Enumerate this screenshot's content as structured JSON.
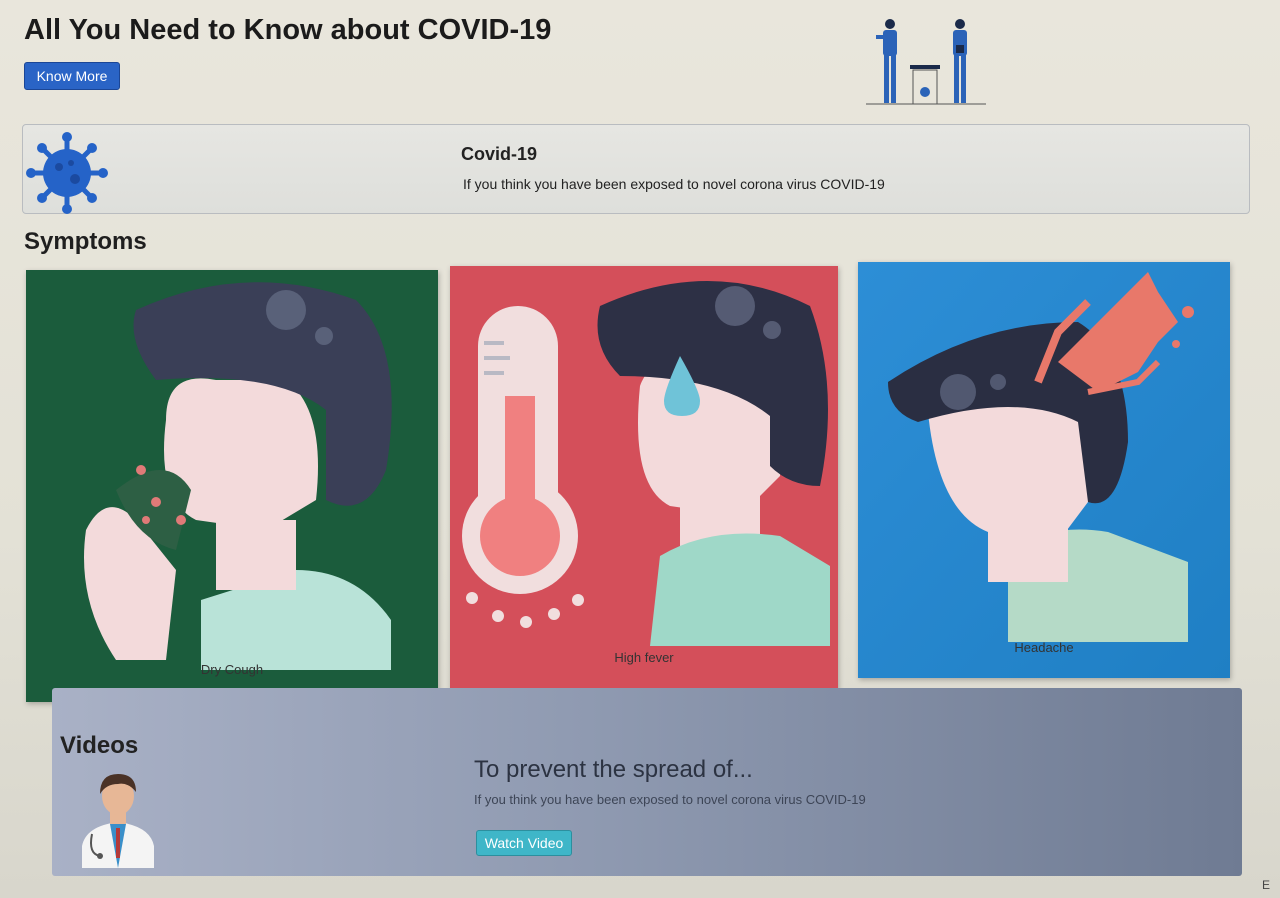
{
  "header": {
    "title": "All You Need to Know about COVID-19",
    "know_more_label": "Know More"
  },
  "info_card": {
    "title": "Covid-19",
    "text": "If you think you have been exposed to novel corona virus COVID-19"
  },
  "symptoms": {
    "heading": "Symptoms",
    "items": [
      {
        "label": "Dry Cough",
        "color": "#1a5a3a"
      },
      {
        "label": "High fever",
        "color": "#cf4a56"
      },
      {
        "label": "Headache",
        "color": "#2388cf"
      }
    ]
  },
  "videos": {
    "heading": "Videos",
    "title": "To prevent the spread of...",
    "text": "If you think you have been exposed to novel corona virus COVID-19",
    "button_label": "Watch Video"
  },
  "taskbar": {
    "hint": "E"
  },
  "colors": {
    "primary_button": "#2a64c6",
    "info_button": "#3fb6c8",
    "virus_blue": "#2563c8"
  },
  "icons": [
    "virus-icon",
    "doctor-icon",
    "thermometer-icon",
    "bin-icon"
  ]
}
